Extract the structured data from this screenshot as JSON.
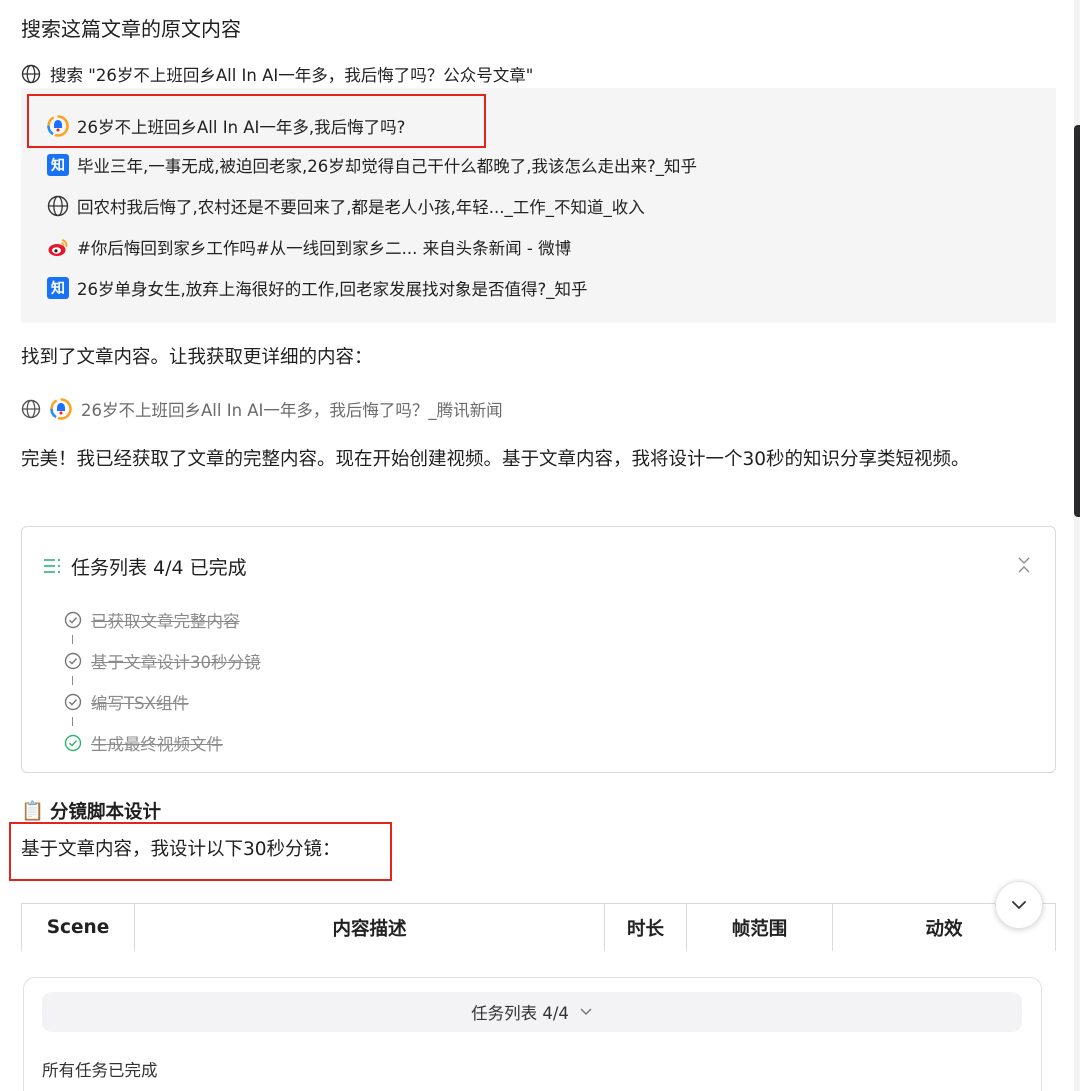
{
  "query_title": "搜索这篇文章的原文内容",
  "search_action": {
    "icon": "globe-icon",
    "label": "搜索 \"26岁不上班回乡All In AI一年多，我后悔了吗？公众号文章\""
  },
  "search_results": [
    {
      "icon": "tencent-news-icon",
      "title": "26岁不上班回乡All In AI一年多,我后悔了吗?"
    },
    {
      "icon": "zhihu-icon",
      "icon_text": "知",
      "title": "毕业三年,一事无成,被迫回老家,26岁却觉得自己干什么都晚了,我该怎么走出来?_知乎"
    },
    {
      "icon": "globe-icon",
      "title": "回农村我后悔了,农村还是不要回来了,都是老人小孩,年轻..._工作_不知道_收入"
    },
    {
      "icon": "weibo-icon",
      "title": "#你后悔回到家乡工作吗#从一线回到家乡二... 来自头条新闻 - 微博"
    },
    {
      "icon": "zhihu-icon",
      "icon_text": "知",
      "title": "26岁单身女生,放弃上海很好的工作,回老家发展找对象是否值得?_知乎"
    }
  ],
  "found_message": "找到了文章内容。让我获取更详细的内容：",
  "fetch_action": {
    "label": "26岁不上班回乡All In AI一年多，我后悔了吗？_腾讯新闻"
  },
  "plan_message": "完美！我已经获取了文章的完整内容。现在开始创建视频。基于文章内容，我将设计一个30秒的知识分享类短视频。",
  "task_list": {
    "title": "任务列表 4/4 已完成",
    "tasks": [
      {
        "label": "已获取文章完整内容",
        "done": true
      },
      {
        "label": "基于文章设计30秒分镜",
        "done": true
      },
      {
        "label": "编写TSX组件",
        "done": true
      },
      {
        "label": "生成最终视频文件",
        "done": true
      }
    ]
  },
  "storyboard": {
    "emoji": "📋",
    "title": "分镜脚本设计",
    "intro": "基于文章内容，我设计以下30秒分镜："
  },
  "table": {
    "headers": [
      "Scene",
      "内容描述",
      "时长",
      "帧范围",
      "动效"
    ]
  },
  "bottom_panel": {
    "pill_label": "任务列表 4/4",
    "status": "所有任务已完成"
  },
  "colors": {
    "highlight_red": "#e1251b",
    "zhihu_blue": "#1772f6",
    "done_green": "#2bb673",
    "muted_gray": "#8a8a8a"
  }
}
